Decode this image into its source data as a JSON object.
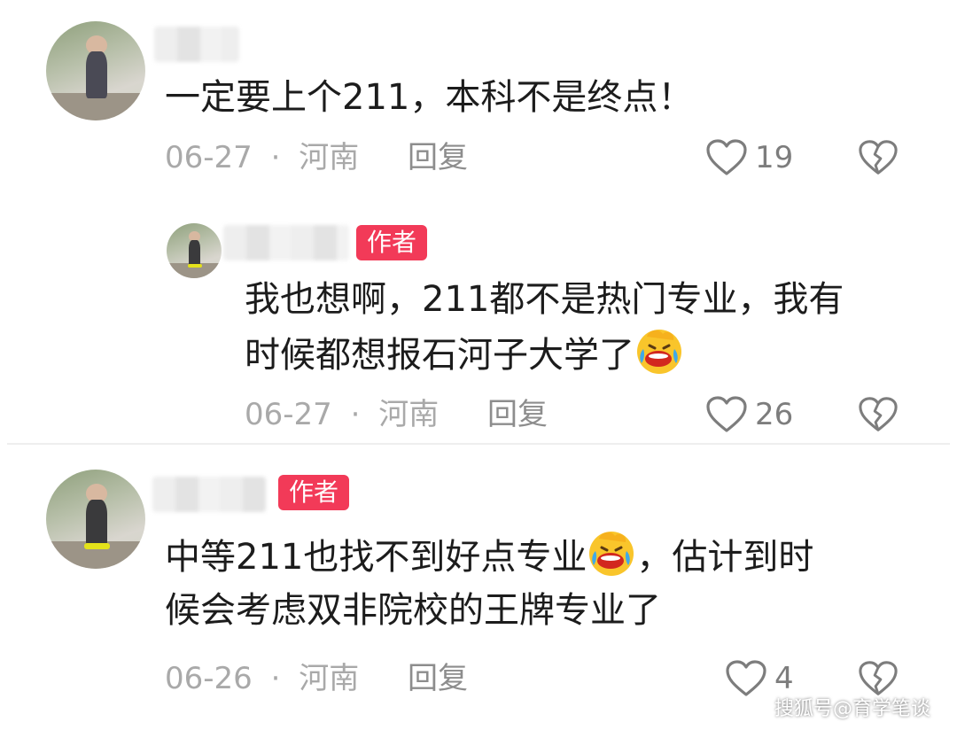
{
  "comments": [
    {
      "text": "一定要上个211，本科不是终点！",
      "date": "06-27",
      "separator": "·",
      "location": "河南",
      "reply_label": "回复",
      "likes": "19"
    },
    {
      "author_badge": "作者",
      "text_line1": "我也想啊，211都不是热门专业，我有",
      "text_line2": "时候都想报石河子大学了",
      "emoji": "laughing-crying-emoji",
      "date": "06-27",
      "separator": "·",
      "location": "河南",
      "reply_label": "回复",
      "likes": "26"
    },
    {
      "author_badge": "作者",
      "text_line1a": "中等211也找不到好点专业",
      "text_line1b": "，估计到时",
      "text_line2": "候会考虑双非院校的王牌专业了",
      "emoji": "laughing-crying-emoji",
      "date": "06-26",
      "separator": "·",
      "location": "河南",
      "reply_label": "回复",
      "likes": "4"
    }
  ],
  "watermark": "搜狐号@育学笔谈",
  "colors": {
    "badge": "#f23a58",
    "meta": "#a9a9a9",
    "text": "#1c1c1c"
  }
}
